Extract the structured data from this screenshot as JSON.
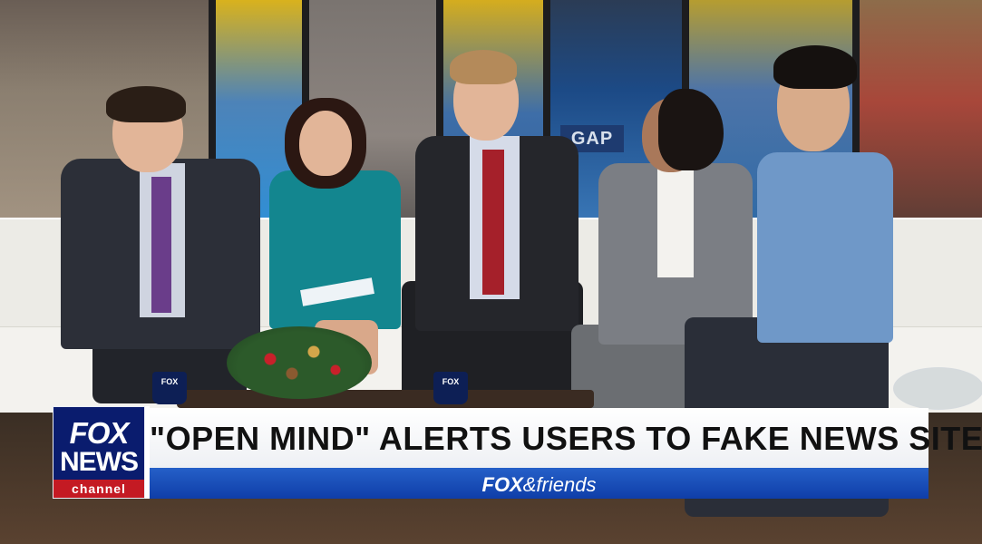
{
  "background": {
    "storefront_sign": "GAP"
  },
  "table": {
    "mug_logo_left": "FOX",
    "mug_logo_right": "FOX"
  },
  "lower_third": {
    "network_logo": {
      "line1": "FOX",
      "line2": "NEWS",
      "line3": "channel"
    },
    "headline": "\"OPEN MIND\" ALERTS USERS TO FAKE NEWS SITES",
    "show_name_bold": "FOX",
    "show_name_rest": "&friends"
  },
  "colors": {
    "logo_blue": "#0a1c6e",
    "logo_red": "#c41a23",
    "bar_blue": "#1a4fb8",
    "headline_bg": "#ffffff"
  }
}
